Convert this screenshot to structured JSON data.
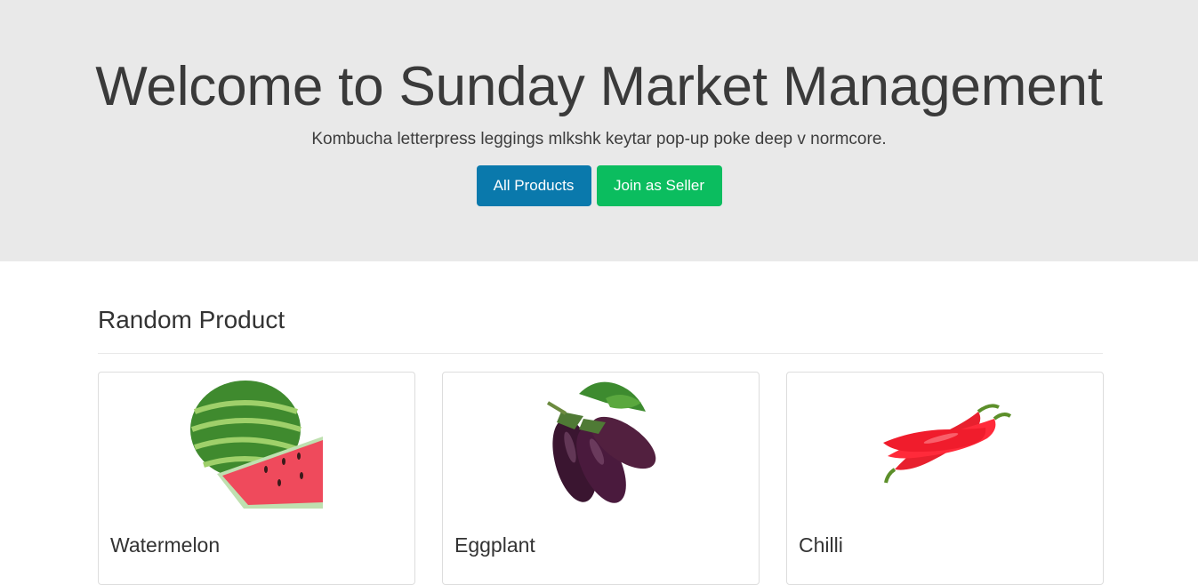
{
  "hero": {
    "title": "Welcome to Sunday Market Management",
    "subtitle": "Kombucha letterpress leggings mlkshk keytar pop-up poke deep v normcore.",
    "primary_button": "All Products",
    "secondary_button": "Join as Seller"
  },
  "section": {
    "title": "Random Product"
  },
  "products": [
    {
      "name": "Watermelon",
      "image": "watermelon-photo"
    },
    {
      "name": "Eggplant",
      "image": "eggplant-photo"
    },
    {
      "name": "Chilli",
      "image": "chilli-photo"
    }
  ],
  "colors": {
    "hero_bg": "#e9e9e9",
    "primary": "#0a79ac",
    "success": "#0bbd5f"
  }
}
